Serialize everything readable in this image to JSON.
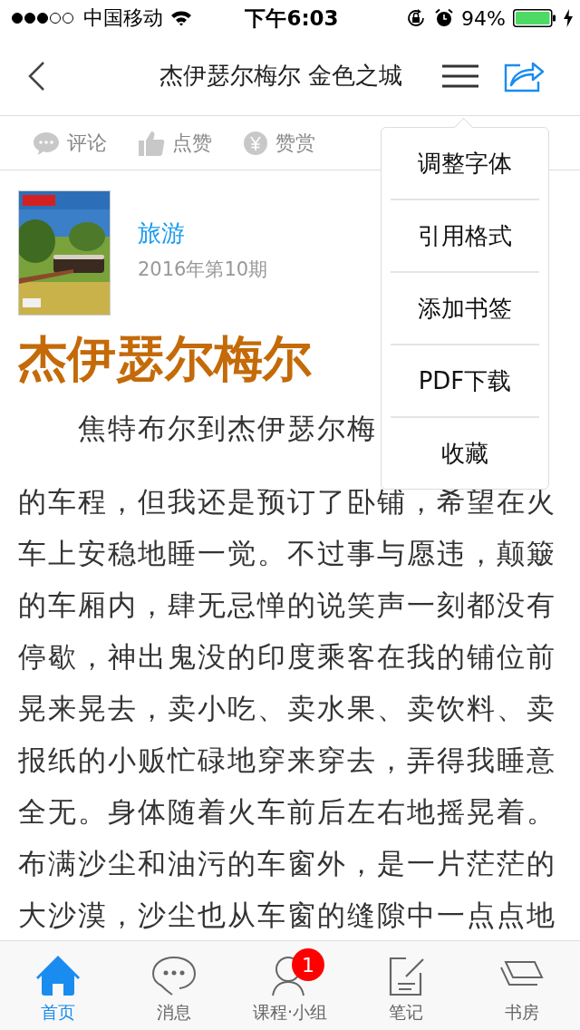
{
  "status_bar": {
    "carrier": "中国移动",
    "time": "下午6:03",
    "battery": "94%"
  },
  "nav": {
    "title": "杰伊瑟尔梅尔 金色之城"
  },
  "actions": [
    {
      "label": "评论",
      "kind": "comment"
    },
    {
      "label": "点赞",
      "kind": "like"
    },
    {
      "label": "赞赏",
      "kind": "reward"
    }
  ],
  "journal": {
    "name": "旅游",
    "issue": "2016年第10期"
  },
  "article": {
    "title": "杰伊瑟尔梅尔",
    "lines": [
      "焦特布尔到杰伊瑟尔梅",
      "的车程，但我还是预订了卧铺，希望在火",
      "车上安稳地睡一觉。不过事与愿违，颠簸",
      "的车厢内，肆无忌惮的说笑声一刻都没有",
      "停歇，神出鬼没的印度乘客在我的铺位前",
      "晃来晃去，卖小吃、卖水果、卖饮料、卖",
      "报纸的小贩忙碌地穿来穿去，弄得我睡意",
      "全无。身体随着火车前后左右地摇晃着。",
      "布满沙尘和油污的车窗外，是一片茫茫的",
      "大沙漠，沙尘也从车窗的缝隙中一点点地"
    ]
  },
  "menu": {
    "items": [
      "调整字体",
      "引用格式",
      "添加书签",
      "PDF下载",
      "收藏"
    ]
  },
  "tab_bar": {
    "tabs": [
      {
        "label": "首页",
        "kind": "home",
        "selected": true
      },
      {
        "label": "消息",
        "kind": "message",
        "selected": false
      },
      {
        "label": "课程·小组",
        "kind": "group",
        "selected": false,
        "badge": "1"
      },
      {
        "label": "笔记",
        "kind": "note",
        "selected": false
      },
      {
        "label": "书房",
        "kind": "library",
        "selected": false
      }
    ]
  }
}
